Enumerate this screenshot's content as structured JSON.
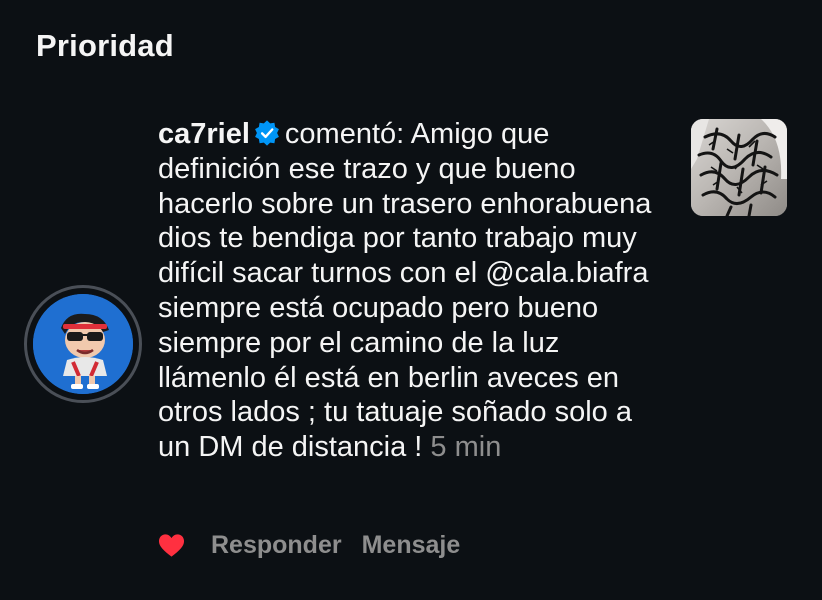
{
  "header": {
    "title": "Prioridad"
  },
  "notification": {
    "username": "ca7riel",
    "verified": true,
    "action": "comentó:",
    "text_before_mention": "Amigo que definición ese trazo y que bueno hacerlo sobre un trasero enhorabuena dios te bendiga por tanto trabajo muy difícil sacar turnos con el",
    "mention": "@cala.biafra",
    "text_after_mention": "siempre está ocupado pero bueno siempre por el camino de la luz llámenlo él está en berlin aveces en otros lados ; tu tatuaje soñado solo a un DM de distancia !",
    "time": "5 min",
    "avatar_icon": "cartoon-character-avatar",
    "post_thumbnail_icon": "tattoo-photo-thumbnail"
  },
  "actions": {
    "like_icon": "heart-icon",
    "reply_label": "Responder",
    "message_label": "Mensaje"
  },
  "colors": {
    "background": "#0c1014",
    "text_primary": "#f5f5f5",
    "text_secondary": "#8e8e8e",
    "verified_blue": "#0095f6",
    "heart_red": "#ff3040",
    "avatar_ring": "#4a4f57"
  }
}
